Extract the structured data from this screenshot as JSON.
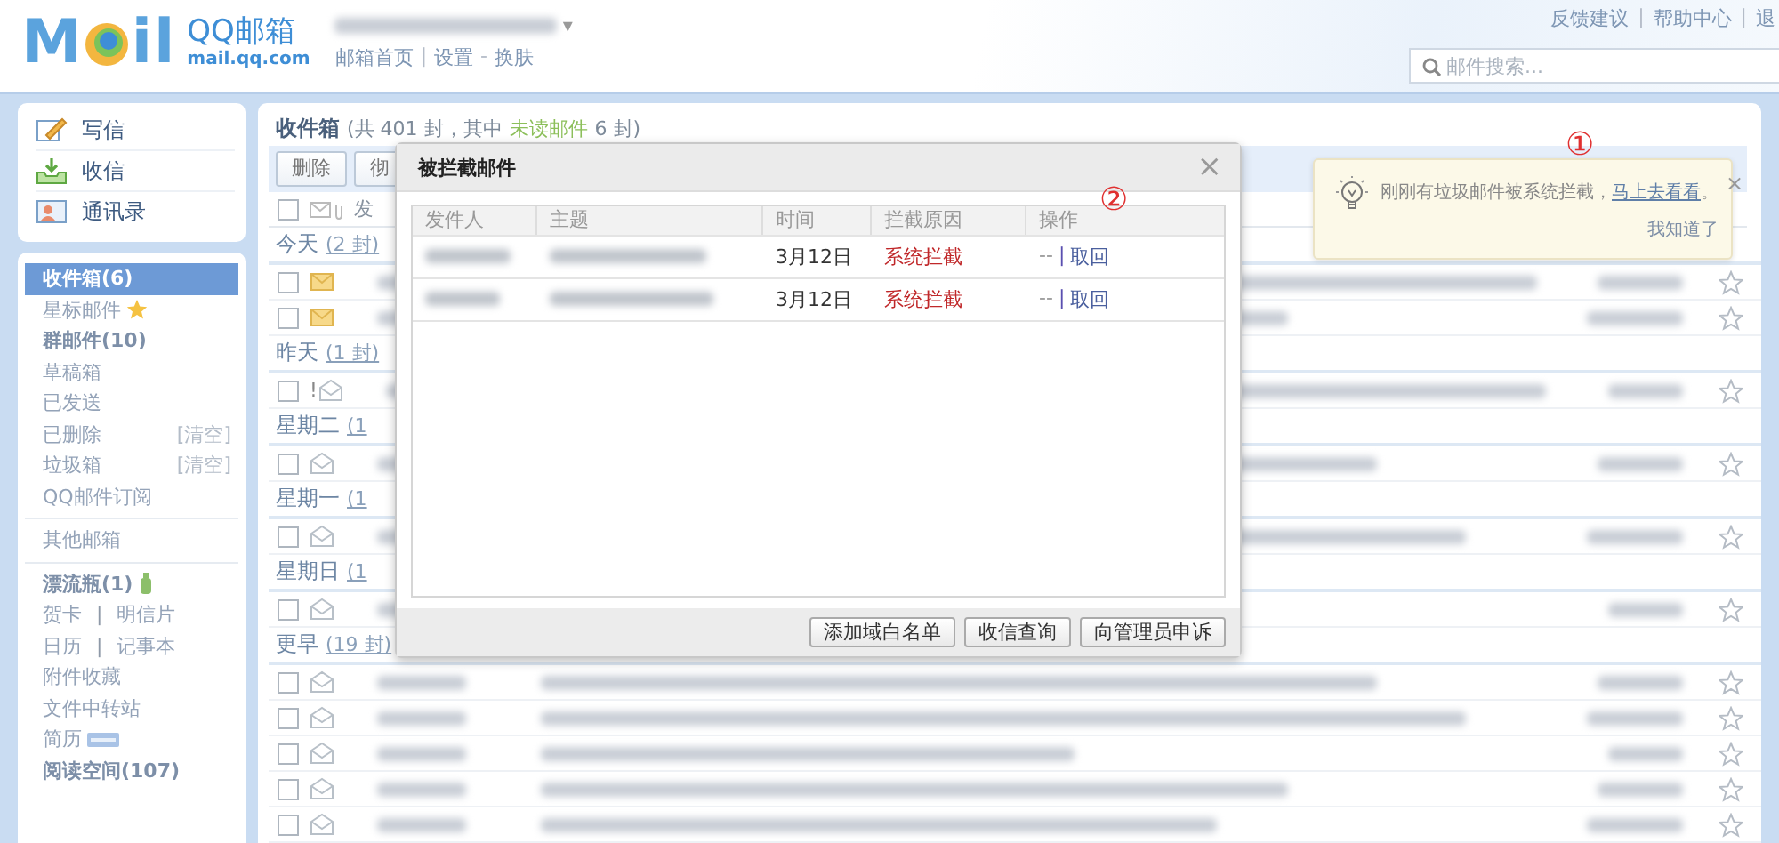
{
  "header": {
    "logo": {
      "left": "M",
      "right": "il",
      "name": "QQ邮箱",
      "domain": "mail.qq.com"
    },
    "account_caret": "▾",
    "nav": [
      {
        "kind": "link",
        "label": "邮箱首页"
      },
      {
        "kind": "sep",
        "label": "|"
      },
      {
        "kind": "link",
        "label": "设置"
      },
      {
        "kind": "sep",
        "label": "-"
      },
      {
        "kind": "link",
        "label": "换肤"
      }
    ],
    "top_links": [
      {
        "kind": "link",
        "label": "反馈建议"
      },
      {
        "kind": "sep",
        "label": "|"
      },
      {
        "kind": "link",
        "label": "帮助中心"
      },
      {
        "kind": "sep",
        "label": "|"
      },
      {
        "kind": "link",
        "label": "退"
      }
    ],
    "search": {
      "placeholder": "邮件搜索..."
    }
  },
  "sidebar": {
    "actions": [
      {
        "kind": "compose",
        "label": "写信"
      },
      {
        "kind": "receive",
        "label": "收信"
      },
      {
        "kind": "contacts",
        "label": "通讯录"
      }
    ],
    "folders": [
      {
        "kind": "folder",
        "label": "收件箱(6)",
        "selected": true,
        "bold": true
      },
      {
        "kind": "folder-star",
        "label": "星标邮件",
        "selected": false,
        "bold": false
      },
      {
        "kind": "folder",
        "label": "群邮件(10)",
        "selected": false,
        "bold": true
      },
      {
        "kind": "folder",
        "label": "草稿箱",
        "selected": false,
        "bold": false
      },
      {
        "kind": "folder",
        "label": "已发送",
        "selected": false,
        "bold": false
      },
      {
        "kind": "folder",
        "label": "已删除",
        "selected": false,
        "bold": false,
        "action": "[清空]"
      },
      {
        "kind": "folder",
        "label": "垃圾箱",
        "selected": false,
        "bold": false,
        "action": "[清空]"
      },
      {
        "kind": "folder",
        "label": "QQ邮件订阅",
        "selected": false,
        "bold": false
      },
      {
        "kind": "divider"
      },
      {
        "kind": "folder",
        "label": "其他邮箱",
        "selected": false,
        "bold": false
      },
      {
        "kind": "divider"
      },
      {
        "kind": "folder-bottle",
        "label": "漂流瓶(1)",
        "selected": false,
        "bold": true
      },
      {
        "kind": "pair",
        "labels": [
          "贺卡",
          "明信片"
        ],
        "sep": "|"
      },
      {
        "kind": "pair",
        "labels": [
          "日历",
          "记事本"
        ],
        "sep": "|"
      },
      {
        "kind": "folder",
        "label": "附件收藏",
        "selected": false,
        "bold": false
      },
      {
        "kind": "folder",
        "label": "文件中转站",
        "selected": false,
        "bold": false
      },
      {
        "kind": "folder-badge",
        "label": "简历",
        "selected": false,
        "bold": false
      },
      {
        "kind": "folder",
        "label": "阅读空间(107)",
        "selected": false,
        "bold": true
      }
    ]
  },
  "mailbox": {
    "title": "收件箱",
    "summary_prefix": "(共 401 封，其中",
    "unread_link": "未读邮件",
    "summary_suffix": "6 封)",
    "toolbar": [
      "删除",
      "彻"
    ],
    "header_label": "发",
    "header_checked": false,
    "groups": [
      {
        "label": "今天",
        "count": "(2 封)",
        "rows": [
          {
            "unread": true,
            "checked": false
          },
          {
            "unread": true,
            "checked": false
          }
        ]
      },
      {
        "label": "昨天",
        "count": "(1 封)",
        "rows": [
          {
            "unread": false,
            "checked": false,
            "mark": "!"
          }
        ]
      },
      {
        "label": "星期二",
        "count": "(1",
        "rows": [
          {
            "unread": false,
            "checked": false
          }
        ]
      },
      {
        "label": "星期一",
        "count": "(1",
        "rows": [
          {
            "unread": false,
            "checked": false
          }
        ]
      },
      {
        "label": "星期日",
        "count": "(1",
        "rows": [
          {
            "unread": false,
            "checked": false
          }
        ]
      },
      {
        "label": "更早",
        "count": "(19 封)",
        "rows": [
          {
            "unread": false,
            "checked": false
          },
          {
            "unread": false,
            "checked": false
          },
          {
            "unread": false,
            "checked": false
          },
          {
            "unread": false,
            "checked": false
          },
          {
            "unread": false,
            "checked": false
          }
        ]
      }
    ]
  },
  "dialog": {
    "title": "被拦截邮件",
    "close": "×",
    "columns": [
      "发件人",
      "主题",
      "时间",
      "拦截原因",
      "操作"
    ],
    "rows": [
      {
        "time": "3月12日",
        "reason": "系统拦截",
        "dash": "--",
        "sep": "|",
        "action": "取回"
      },
      {
        "time": "3月12日",
        "reason": "系统拦截",
        "dash": "--",
        "sep": "|",
        "action": "取回"
      }
    ],
    "buttons": [
      "添加域白名单",
      "收信查询",
      "向管理员申诉"
    ]
  },
  "tip": {
    "text": "刚刚有垃圾邮件被系统拦截，",
    "link": "马上去看看",
    "end": "。",
    "dismiss": "我知道了",
    "close": "×"
  },
  "annotations": [
    "①",
    "②"
  ]
}
